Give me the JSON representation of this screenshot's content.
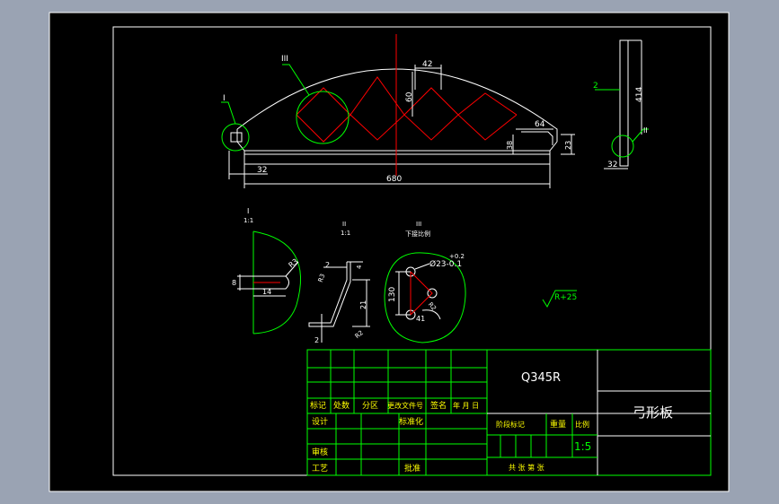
{
  "colors": {
    "background": "#9aa3b3",
    "paper": "#000000",
    "line": "#ffffff",
    "table": "#00ff00",
    "dim": "#00ff00",
    "center": "#ff0000",
    "hatch": "#ffff00"
  },
  "main_view": {
    "detail_I": "I",
    "detail_III": "III",
    "dim_42": "42",
    "dim_60": "60",
    "dim_64": "64",
    "dim_38": "38",
    "dim_23": "23",
    "dim_32": "32",
    "dim_680": "680"
  },
  "side_view": {
    "dim_2": "2",
    "dim_414": "414",
    "detail_II": "II",
    "dim_32": "32"
  },
  "detail_I": {
    "title": "I",
    "scale": "1:1",
    "dim_R3": "R3",
    "dim_8": "8",
    "dim_14": "14"
  },
  "detail_II": {
    "title": "II",
    "scale": "1:1",
    "dim_2a": "2",
    "dim_4": "4",
    "dim_R3": "R3",
    "dim_21": "21",
    "dim_2b": "2",
    "dim_R2": "R2"
  },
  "detail_III": {
    "title": "III",
    "subtitle": "下接比例",
    "tol": "+0.2",
    "dim_hole": "Ø23-0.1",
    "dim_130": "130",
    "dim_41": "41",
    "dim_R": "R2"
  },
  "roughness": "R+25",
  "title_block": {
    "material": "Q345R",
    "part_name": "弓形板",
    "labels": {
      "mark": "标记",
      "count": "处数",
      "zone": "分区",
      "change_doc": "更改文件号",
      "sign": "签名",
      "date": "年 月 日",
      "design": "设计",
      "standard": "标准化",
      "review": "审核",
      "process": "工艺",
      "approve": "批准",
      "stage": "阶段标记",
      "weight": "重量",
      "scale": "比例",
      "sheets": "共  张  第  张"
    },
    "scale_value": "1:5"
  }
}
